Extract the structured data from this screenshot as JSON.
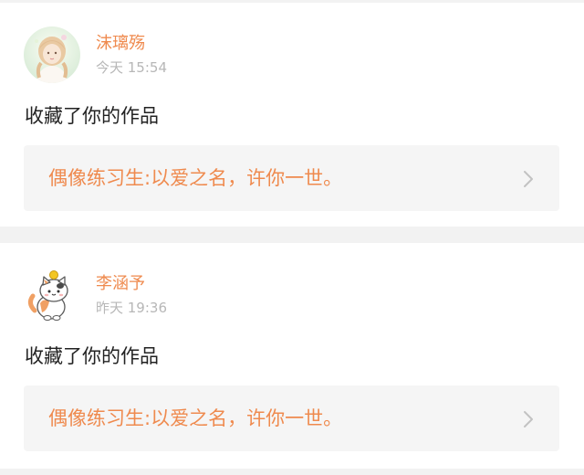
{
  "colors": {
    "page_background": "#f2f2f2",
    "card_background": "#ffffff",
    "username": "#ef8a4e",
    "work_title": "#ef8a4e",
    "timestamp": "#b7b7b7",
    "action_text": "#222222",
    "link_box_background": "#f5f5f5",
    "chevron": "#c2c2c2"
  },
  "notifications": [
    {
      "user": {
        "name": "沫璃殇",
        "avatar_icon": "girl-photo-avatar"
      },
      "time": "今天 15:54",
      "action": "收藏了你的作品",
      "work_title": "偶像练习生:以爱之名，许你一世。",
      "chevron_icon": "chevron-right-icon"
    },
    {
      "user": {
        "name": "李涵予",
        "avatar_icon": "cartoon-cat-avatar"
      },
      "time": "昨天 19:36",
      "action": "收藏了你的作品",
      "work_title": "偶像练习生:以爱之名，许你一世。",
      "chevron_icon": "chevron-right-icon"
    }
  ]
}
